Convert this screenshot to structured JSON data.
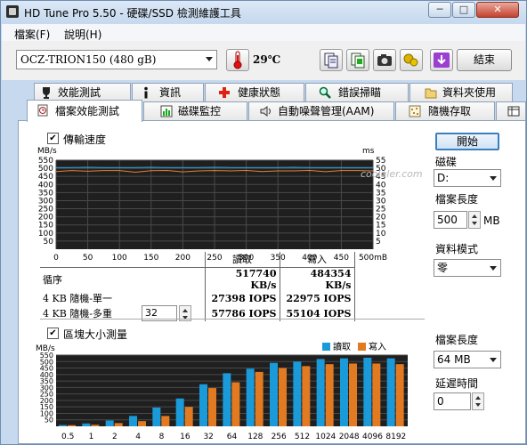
{
  "window": {
    "title": "HD Tune Pro 5.50 - 硬碟/SSD 檢測維護工具",
    "minimize": "─",
    "maximize": "□",
    "close": "✕"
  },
  "menu": {
    "items": [
      "檔案(F)",
      "說明(H)"
    ]
  },
  "toolbar": {
    "drive": "OCZ-TRION150 (480 gB)",
    "temperature": "29℃",
    "exit_label": "結束",
    "icons": [
      "thermometer-icon",
      "copy-info-icon",
      "copy-all-icon",
      "camera-icon",
      "options-icon",
      "download-icon"
    ]
  },
  "tabs_row1": [
    "效能測試",
    "資訊",
    "健康狀態",
    "錯誤掃瞄",
    "資料夾使用"
  ],
  "tabs_row2": [
    "檔案效能測試",
    "磁碟監控",
    "自動噪聲管理(AAM)",
    "隨機存取",
    ""
  ],
  "panel": {
    "transfer_checkbox_label": "傳輸速度",
    "transfer_checked": "✔",
    "start_button": "開始",
    "drive_label": "磁碟",
    "drive_value": "D:",
    "file_length_label": "檔案長度",
    "file_length_value": "500",
    "file_length_unit": "MB",
    "pattern_label": "資料模式",
    "pattern_value": "零",
    "block_checkbox_label": "區塊大小測量",
    "block_checked": "✔",
    "block_length_label": "檔案長度",
    "block_length_value": "64 MB",
    "delay_label": "延遲時間",
    "delay_value": "0"
  },
  "results": {
    "col_read": "讀取",
    "col_write": "寫入",
    "rows": [
      {
        "label": "循序",
        "read": "517740 KB/s",
        "write": "484354 KB/s"
      },
      {
        "label": "4 KB 隨機-單一",
        "read": "27398 IOPS",
        "write": "22975 IOPS"
      },
      {
        "label": "4 KB 隨機-多重",
        "read": "57786 IOPS",
        "write": "55104 IOPS"
      }
    ],
    "queue_depth": "32"
  },
  "watermark": "coolaler.com",
  "chart_data": [
    {
      "type": "line",
      "title": "",
      "y_left_unit": "MB/s",
      "y_right_unit": "ms",
      "x_unit": "mB",
      "x_ticks": [
        "0",
        "50",
        "100",
        "150",
        "200",
        "250",
        "300",
        "350",
        "400",
        "450",
        "500mB"
      ],
      "x_range": [
        0,
        500
      ],
      "y_left_ticks": [
        "550",
        "500",
        "450",
        "400",
        "350",
        "300",
        "250",
        "200",
        "150",
        "100",
        "50"
      ],
      "y_right_ticks": [
        "55",
        "50",
        "45",
        "40",
        "35",
        "30",
        "25",
        "20",
        "15",
        "10",
        "5"
      ],
      "y_left_range": [
        0,
        550
      ],
      "y_right_range": [
        0,
        55
      ],
      "grid": true,
      "series": [
        {
          "color": "#33a6e0",
          "values": [
            505,
            505,
            506,
            505,
            505,
            505,
            506,
            505,
            505,
            505,
            506,
            505,
            505,
            505,
            505,
            506,
            505,
            505,
            505,
            505,
            505
          ]
        },
        {
          "color": "#e28438",
          "values": [
            480,
            486,
            482,
            486,
            486,
            476,
            485,
            487,
            478,
            484,
            486,
            484,
            487,
            480,
            484,
            484,
            487,
            479,
            486,
            486,
            484
          ]
        }
      ]
    },
    {
      "type": "bar",
      "title": "",
      "ylabel": "MB/s",
      "categories": [
        "0.5",
        "1",
        "2",
        "4",
        "8",
        "16",
        "32",
        "64",
        "128",
        "256",
        "512",
        "1024",
        "2048",
        "4096",
        "8192"
      ],
      "y_ticks": [
        "550",
        "500",
        "450",
        "400",
        "350",
        "300",
        "250",
        "200",
        "150",
        "100",
        "50"
      ],
      "ylim": [
        0,
        550
      ],
      "grid": true,
      "legend_position": "top-right",
      "series": [
        {
          "name": "讀取",
          "color": "#1a9ad8",
          "values": [
            10,
            22,
            45,
            80,
            145,
            215,
            325,
            410,
            445,
            490,
            500,
            520,
            525,
            530,
            525
          ]
        },
        {
          "name": "寫入",
          "color": "#e27a22",
          "values": [
            9,
            12,
            25,
            40,
            80,
            150,
            295,
            340,
            420,
            450,
            465,
            480,
            485,
            485,
            480
          ]
        }
      ]
    }
  ]
}
